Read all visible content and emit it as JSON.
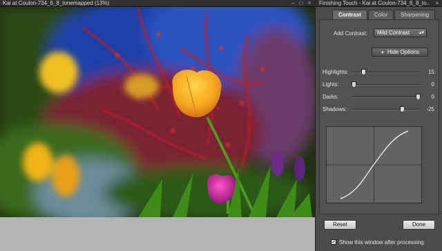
{
  "image_window": {
    "title": "Kai at Coulon-734_6_8_tonemapped (13%)",
    "controls": {
      "minimize": "–",
      "maximize": "□",
      "close": "×"
    }
  },
  "panel": {
    "title": "Finishing Touch - Kai at Coulon-734_6_8_to...",
    "close": "×",
    "tabs": [
      "Contrast",
      "Color",
      "Sharpening"
    ],
    "active_tab": "Contrast",
    "add_contrast_label": "Add Contrast:",
    "add_contrast_value": "Mild Contrast",
    "hide_options_label": "Hide Options",
    "sliders": [
      {
        "label": "Highlights:",
        "value": "15",
        "fraction": 0.15
      },
      {
        "label": "Lights:",
        "value": "0",
        "fraction": 0.0
      },
      {
        "label": "Darks:",
        "value": "0",
        "fraction": 1.0
      },
      {
        "label": "Shadows:",
        "value": "-25",
        "fraction": 0.75
      }
    ],
    "reset_label": "Reset",
    "done_label": "Done",
    "show_window_label": "Show this window after processing",
    "show_window_checked": true
  },
  "colors": {
    "panel_bg": "#4c4c4c",
    "curve_line": "#ffffff",
    "tulip_yellow": "#f6a623",
    "tulip_magenta": "#c0209a"
  },
  "icons": [
    "minimize-icon",
    "maximize-icon",
    "close-icon",
    "dropdown-arrow-icon",
    "triangle-down-icon",
    "checkmark-icon"
  ]
}
